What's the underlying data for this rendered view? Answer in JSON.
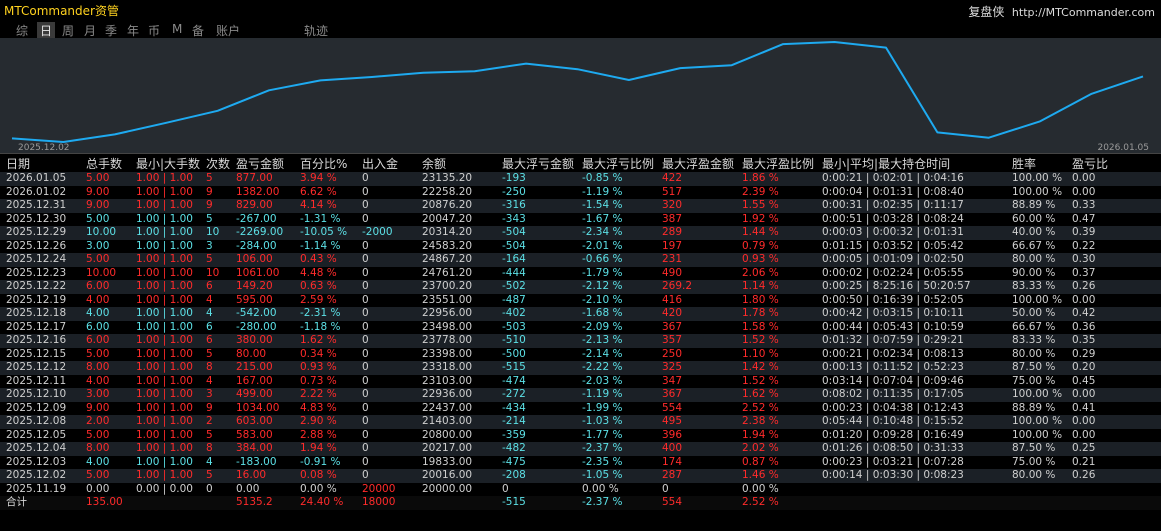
{
  "app": {
    "title": "MTCommander资管",
    "brand_name": "复盘侠",
    "brand_url": "http://MTCommander.com"
  },
  "tabs": [
    {
      "label": "综",
      "active": false
    },
    {
      "label": "日",
      "active": true
    },
    {
      "label": "周",
      "active": false
    },
    {
      "label": "月",
      "active": false
    },
    {
      "label": "季",
      "active": false
    },
    {
      "label": "年",
      "active": false
    },
    {
      "label": "币",
      "active": false
    },
    {
      "label": "M",
      "active": false
    },
    {
      "label": "备",
      "active": false
    },
    {
      "label": "账户",
      "active": false
    },
    {
      "label": "轨迹",
      "active": false
    }
  ],
  "chart_data": {
    "type": "line",
    "x_start_label": "2025.12.02",
    "x_end_label": "2026.01.05",
    "series_color": "#1eaaf0",
    "y": [
      20016.0,
      19833.0,
      20217.0,
      20800.0,
      21403.0,
      22437.0,
      22936.0,
      23103.0,
      23318.0,
      23398.0,
      23778.0,
      23498.0,
      22956.0,
      23551.0,
      23700.2,
      24761.2,
      24867.2,
      24583.2,
      20314.2,
      20047.2,
      20876.2,
      22258.2,
      23135.2
    ]
  },
  "table": {
    "headers": [
      "日期",
      "总手数",
      "最小|大手数",
      "次数",
      "盈亏金额",
      "百分比%",
      "出入金",
      "余额",
      "最大浮亏金额",
      "最大浮亏比例",
      "最大浮盈金额",
      "最大浮盈比例",
      "最小|平均|最大持仓时间",
      "胜率",
      "盈亏比"
    ],
    "rows": [
      [
        "2026.01.05",
        "5.00",
        "1.00 | 1.00",
        "5",
        "877.00",
        "3.94 %",
        "0",
        "23135.20",
        "-193",
        "-0.85 %",
        "422",
        "1.86 %",
        "0:00:21 | 0:02:01 | 0:04:16",
        "100.00 %",
        "0.00"
      ],
      [
        "2026.01.02",
        "9.00",
        "1.00 | 1.00",
        "9",
        "1382.00",
        "6.62 %",
        "0",
        "22258.20",
        "-250",
        "-1.19 %",
        "517",
        "2.39 %",
        "0:00:04 | 0:01:31 | 0:08:40",
        "100.00 %",
        "0.00"
      ],
      [
        "2025.12.31",
        "9.00",
        "1.00 | 1.00",
        "9",
        "829.00",
        "4.14 %",
        "0",
        "20876.20",
        "-316",
        "-1.54 %",
        "320",
        "1.55 %",
        "0:00:31 | 0:02:35 | 0:11:17",
        "88.89 %",
        "0.33"
      ],
      [
        "2025.12.30",
        "5.00",
        "1.00 | 1.00",
        "5",
        "-267.00",
        "-1.31 %",
        "0",
        "20047.20",
        "-343",
        "-1.67 %",
        "387",
        "1.92 %",
        "0:00:51 | 0:03:28 | 0:08:24",
        "60.00 %",
        "0.47"
      ],
      [
        "2025.12.29",
        "10.00",
        "1.00 | 1.00",
        "10",
        "-2269.00",
        "-10.05 %",
        "-2000",
        "20314.20",
        "-504",
        "-2.34 %",
        "289",
        "1.44 %",
        "0:00:03 | 0:00:32 | 0:01:31",
        "40.00 %",
        "0.39"
      ],
      [
        "2025.12.26",
        "3.00",
        "1.00 | 1.00",
        "3",
        "-284.00",
        "-1.14 %",
        "0",
        "24583.20",
        "-504",
        "-2.01 %",
        "197",
        "0.79 %",
        "0:01:15 | 0:03:52 | 0:05:42",
        "66.67 %",
        "0.22"
      ],
      [
        "2025.12.24",
        "5.00",
        "1.00 | 1.00",
        "5",
        "106.00",
        "0.43 %",
        "0",
        "24867.20",
        "-164",
        "-0.66 %",
        "231",
        "0.93 %",
        "0:00:05 | 0:01:09 | 0:02:50",
        "80.00 %",
        "0.30"
      ],
      [
        "2025.12.23",
        "10.00",
        "1.00 | 1.00",
        "10",
        "1061.00",
        "4.48 %",
        "0",
        "24761.20",
        "-444",
        "-1.79 %",
        "490",
        "2.06 %",
        "0:00:02 | 0:02:24 | 0:05:55",
        "90.00 %",
        "0.37"
      ],
      [
        "2025.12.22",
        "6.00",
        "1.00 | 1.00",
        "6",
        "149.20",
        "0.63 %",
        "0",
        "23700.20",
        "-502",
        "-2.12 %",
        "269.2",
        "1.14 %",
        "0:00:25 | 8:25:16 | 50:20:57",
        "83.33 %",
        "0.26"
      ],
      [
        "2025.12.19",
        "4.00",
        "1.00 | 1.00",
        "4",
        "595.00",
        "2.59 %",
        "0",
        "23551.00",
        "-487",
        "-2.10 %",
        "416",
        "1.80 %",
        "0:00:50 | 0:16:39 | 0:52:05",
        "100.00 %",
        "0.00"
      ],
      [
        "2025.12.18",
        "4.00",
        "1.00 | 1.00",
        "4",
        "-542.00",
        "-2.31 %",
        "0",
        "22956.00",
        "-402",
        "-1.68 %",
        "420",
        "1.78 %",
        "0:00:42 | 0:03:15 | 0:10:11",
        "50.00 %",
        "0.42"
      ],
      [
        "2025.12.17",
        "6.00",
        "1.00 | 1.00",
        "6",
        "-280.00",
        "-1.18 %",
        "0",
        "23498.00",
        "-503",
        "-2.09 %",
        "367",
        "1.58 %",
        "0:00:44 | 0:05:43 | 0:10:59",
        "66.67 %",
        "0.36"
      ],
      [
        "2025.12.16",
        "6.00",
        "1.00 | 1.00",
        "6",
        "380.00",
        "1.62 %",
        "0",
        "23778.00",
        "-510",
        "-2.13 %",
        "357",
        "1.52 %",
        "0:01:32 | 0:07:59 | 0:29:21",
        "83.33 %",
        "0.35"
      ],
      [
        "2025.12.15",
        "5.00",
        "1.00 | 1.00",
        "5",
        "80.00",
        "0.34 %",
        "0",
        "23398.00",
        "-500",
        "-2.14 %",
        "250",
        "1.10 %",
        "0:00:21 | 0:02:34 | 0:08:13",
        "80.00 %",
        "0.29"
      ],
      [
        "2025.12.12",
        "8.00",
        "1.00 | 1.00",
        "8",
        "215.00",
        "0.93 %",
        "0",
        "23318.00",
        "-515",
        "-2.22 %",
        "325",
        "1.42 %",
        "0:00:13 | 0:11:52 | 0:52:23",
        "87.50 %",
        "0.20"
      ],
      [
        "2025.12.11",
        "4.00",
        "1.00 | 1.00",
        "4",
        "167.00",
        "0.73 %",
        "0",
        "23103.00",
        "-474",
        "-2.03 %",
        "347",
        "1.52 %",
        "0:03:14 | 0:07:04 | 0:09:46",
        "75.00 %",
        "0.45"
      ],
      [
        "2025.12.10",
        "3.00",
        "1.00 | 1.00",
        "3",
        "499.00",
        "2.22 %",
        "0",
        "22936.00",
        "-272",
        "-1.19 %",
        "367",
        "1.62 %",
        "0:08:02 | 0:11:35 | 0:17:05",
        "100.00 %",
        "0.00"
      ],
      [
        "2025.12.09",
        "9.00",
        "1.00 | 1.00",
        "9",
        "1034.00",
        "4.83 %",
        "0",
        "22437.00",
        "-434",
        "-1.99 %",
        "554",
        "2.52 %",
        "0:00:23 | 0:04:38 | 0:12:43",
        "88.89 %",
        "0.41"
      ],
      [
        "2025.12.08",
        "2.00",
        "1.00 | 1.00",
        "2",
        "603.00",
        "2.90 %",
        "0",
        "21403.00",
        "-214",
        "-1.03 %",
        "495",
        "2.38 %",
        "0:05:44 | 0:10:48 | 0:15:52",
        "100.00 %",
        "0.00"
      ],
      [
        "2025.12.05",
        "5.00",
        "1.00 | 1.00",
        "5",
        "583.00",
        "2.88 %",
        "0",
        "20800.00",
        "-359",
        "-1.77 %",
        "396",
        "1.94 %",
        "0:01:20 | 0:09:28 | 0:16:49",
        "100.00 %",
        "0.00"
      ],
      [
        "2025.12.04",
        "8.00",
        "1.00 | 1.00",
        "8",
        "384.00",
        "1.94 %",
        "0",
        "20217.00",
        "-482",
        "-2.37 %",
        "400",
        "2.02 %",
        "0:01:26 | 0:08:50 | 0:31:33",
        "87.50 %",
        "0.25"
      ],
      [
        "2025.12.03",
        "4.00",
        "1.00 | 1.00",
        "4",
        "-183.00",
        "-0.91 %",
        "0",
        "19833.00",
        "-475",
        "-2.35 %",
        "174",
        "0.87 %",
        "0:00:23 | 0:03:21 | 0:07:28",
        "75.00 %",
        "0.21"
      ],
      [
        "2025.12.02",
        "5.00",
        "1.00 | 1.00",
        "5",
        "16.00",
        "0.08 %",
        "0",
        "20016.00",
        "-208",
        "-1.05 %",
        "287",
        "1.46 %",
        "0:00:14 | 0:03:30 | 0:08:23",
        "80.00 %",
        "0.26"
      ],
      [
        "2025.11.19",
        "0.00",
        "0.00 | 0.00",
        "0",
        "0.00",
        "0.00 %",
        "20000",
        "20000.00",
        "0",
        "0.00 %",
        "0",
        "0.00 %",
        "",
        "",
        ""
      ]
    ],
    "row_kind": [
      "p",
      "p",
      "p",
      "l",
      "l",
      "l",
      "p",
      "p",
      "p",
      "p",
      "l",
      "l",
      "p",
      "p",
      "p",
      "p",
      "p",
      "p",
      "p",
      "p",
      "p",
      "l",
      "p",
      "z"
    ],
    "total": {
      "label": "合计",
      "lots": "135.00",
      "pnl": "5135.2",
      "pct": "24.40 %",
      "deposit": "18000",
      "max_float_loss": "-515",
      "max_float_loss_pct": "-2.37 %",
      "max_float_profit": "554",
      "max_float_profit_pct": "2.52 %"
    }
  }
}
